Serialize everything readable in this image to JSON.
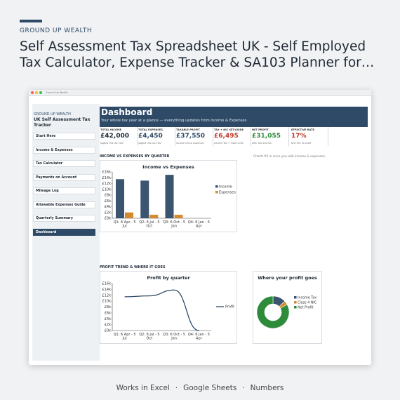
{
  "brand": "GROUND UP WEALTH",
  "headline_line1": "Self Assessment Tax Spreadsheet UK - Self Employed",
  "headline_line2": "Tax Calculator, Expense Tracker & SA103 Planner for…",
  "footer": {
    "items": [
      "Works in Excel",
      "Google Sheets",
      "Numbers"
    ],
    "separator": "·"
  },
  "window": {
    "title": "Ground Up Wealth"
  },
  "sidebar": {
    "brand": "GROUND UP WEALTH",
    "title": "UK Self Assessment Tax Tracker",
    "items": [
      {
        "label": "Start Here",
        "active": false
      },
      {
        "label": "Income & Expenses",
        "active": false
      },
      {
        "label": "Tax Calculator",
        "active": false
      },
      {
        "label": "Payments on Account",
        "active": false
      },
      {
        "label": "Mileage Log",
        "active": false
      },
      {
        "label": "Allowable Expenses Guide",
        "active": false
      },
      {
        "label": "Quarterly Summary",
        "active": false
      },
      {
        "label": "Dashboard",
        "active": true
      }
    ]
  },
  "dashboard": {
    "title": "Dashboard",
    "subtitle": "Your whole tax year at a glance — everything updates from Income & Expenses"
  },
  "kpis": [
    {
      "label": "TOTAL INCOME",
      "value": "£42,000",
      "sub": "logged this tax year",
      "color": "#1f2a36"
    },
    {
      "label": "TOTAL EXPENSES",
      "value": "£4,450",
      "sub": "logged this tax year",
      "color": "#2f4a67"
    },
    {
      "label": "TAXABLE PROFIT",
      "value": "£37,550",
      "sub": "income minus expenses",
      "color": "#2f4a67"
    },
    {
      "label": "TAX + NIC SET-ASIDE",
      "value": "£6,495",
      "sub": "Income Tax + Class 4 NIC",
      "color": "#c0392b"
    },
    {
      "label": "NET PROFIT",
      "value": "£31,055",
      "sub": "after tax and NIC",
      "color": "#2e8b3a"
    },
    {
      "label": "EFFECTIVE RATE",
      "value": "17%",
      "sub": "tax+NIC vs profit",
      "color": "#c0392b"
    }
  ],
  "sections": {
    "income_vs_expenses": "INCOME VS EXPENSES BY QUARTER",
    "profit_trend": "PROFIT TREND & WHERE IT GOES",
    "charts_note": "Charts fill in once you add income & expenses."
  },
  "chart_data": [
    {
      "type": "bar",
      "title": "Income vs Expenses",
      "categories": [
        "Q1: 6 Apr - 5 Jul",
        "Q2: 6 Jul - 5 Oct",
        "Q3: 6 Oct - 5 Jan",
        "Q4: 6 Jan - 5 Apr"
      ],
      "category_lines": [
        [
          "Q1: 6 Apr - 5",
          "Jul"
        ],
        [
          "Q2: 6 Jul - 5",
          "Oct"
        ],
        [
          "Q3: 6 Oct - 5",
          "Jan"
        ],
        [
          "Q4: 6 Jan - 5",
          "Apr"
        ]
      ],
      "series": [
        {
          "name": "Income",
          "values": [
            13500,
            13000,
            15000,
            0
          ],
          "color": "#3b5470"
        },
        {
          "name": "Expenses",
          "values": [
            2000,
            1200,
            1200,
            0
          ],
          "color": "#d48a2c"
        }
      ],
      "yticks": [
        "£0k",
        "£2k",
        "£4k",
        "£6k",
        "£8k",
        "£10k",
        "£12k",
        "£14k",
        "£16k"
      ],
      "ylim": [
        0,
        16000
      ],
      "legend": "right"
    },
    {
      "type": "line",
      "title": "Profit by quarter",
      "categories": [
        "Q1: 6 Apr - 5 Jul",
        "Q2: 6 Jul - 5 Oct",
        "Q3: 6 Oct - 5 Jan",
        "Q4: 6 Jan - 5 Apr"
      ],
      "category_lines": [
        [
          "Q1: 6 Apr - 5",
          "Jul"
        ],
        [
          "Q2: 6 Jul - 5",
          "Oct"
        ],
        [
          "Q3: 6 Oct - 5",
          "Jan"
        ],
        [
          "Q4: 6 Jan - 5",
          "Apr"
        ]
      ],
      "series": [
        {
          "name": "Profit",
          "values": [
            11500,
            11800,
            13800,
            0
          ],
          "color": "#2f4a67"
        }
      ],
      "yticks": [
        "£0k",
        "£2k",
        "£4k",
        "£6k",
        "£8k",
        "£10k",
        "£12k",
        "£14k",
        "£16k"
      ],
      "ylim": [
        0,
        16000
      ],
      "legend": "right"
    },
    {
      "type": "pie",
      "title": "Where your profit goes",
      "slices": [
        {
          "name": "Income Tax",
          "value": 13,
          "color": "#3b5470"
        },
        {
          "name": "Class 4 NIC",
          "value": 4,
          "color": "#d48a2c"
        },
        {
          "name": "Net Profit",
          "value": 83,
          "color": "#2e8b3a"
        }
      ],
      "legend": "right"
    }
  ]
}
